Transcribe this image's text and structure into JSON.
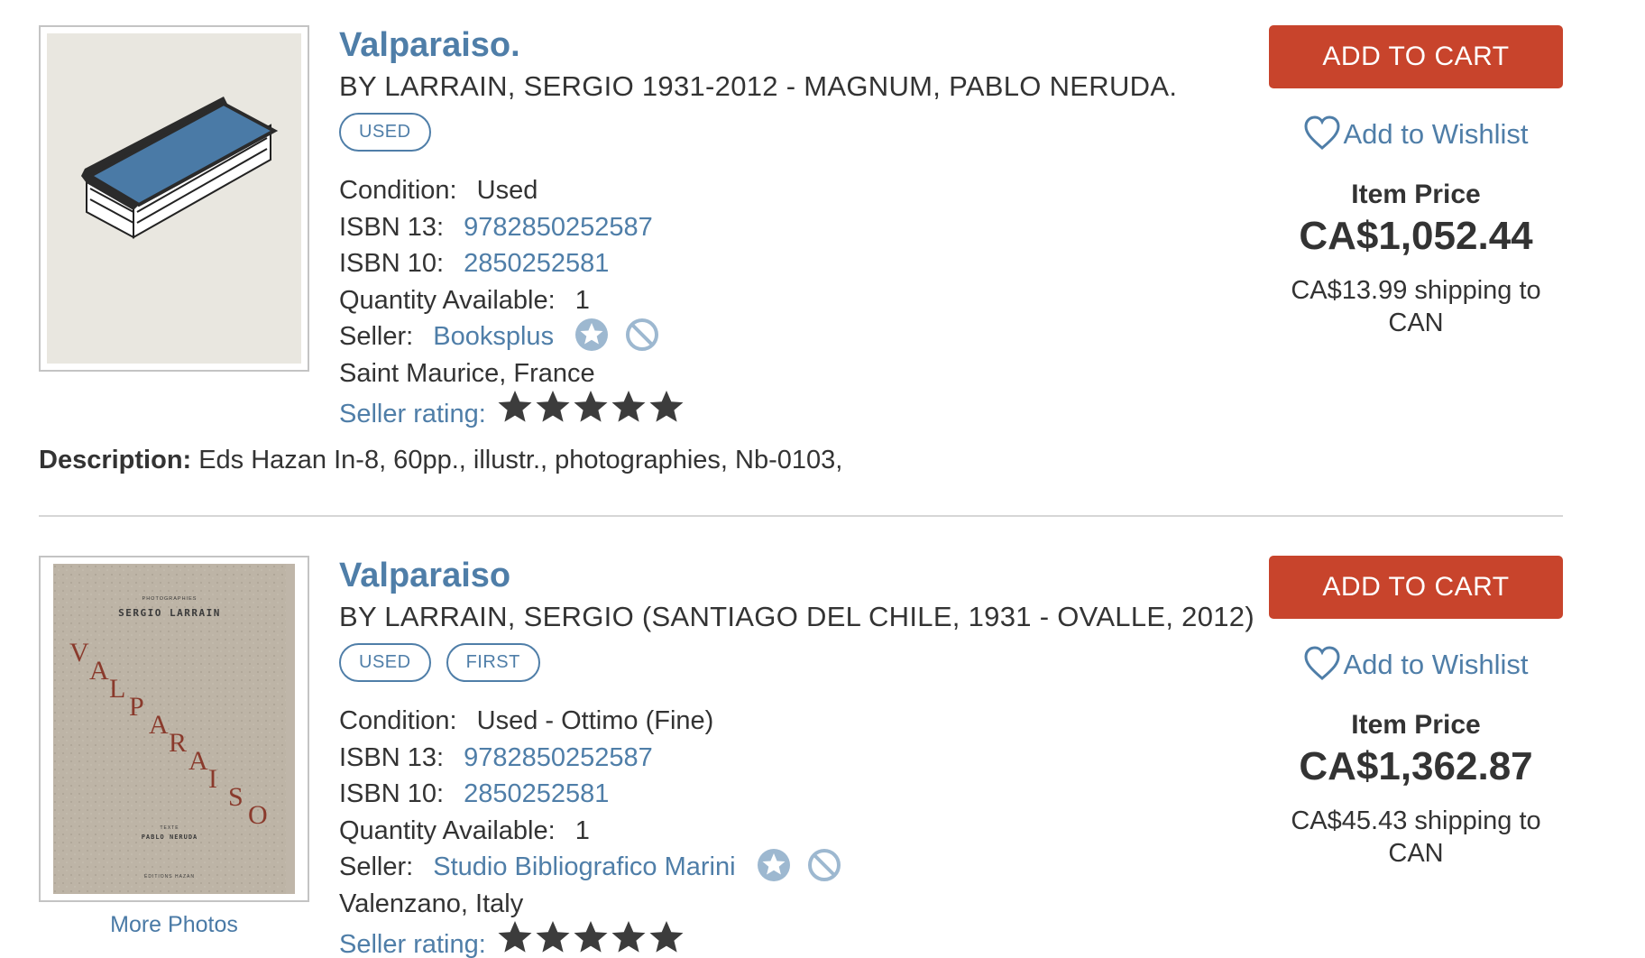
{
  "listings": [
    {
      "title": "Valparaiso.",
      "author": "BY LARRAIN, SERGIO 1931-2012 - MAGNUM, PABLO NERUDA.",
      "tags": [
        "USED"
      ],
      "condition_label": "Condition:",
      "condition": "Used",
      "isbn13_label": "ISBN 13:",
      "isbn13": "9782850252587",
      "isbn10_label": "ISBN 10:",
      "isbn10": "2850252581",
      "quantity_label": "Quantity Available:",
      "quantity": "1",
      "seller_label": "Seller:",
      "seller": "Booksplus",
      "location": "Saint Maurice, France",
      "rating_label": "Seller rating:",
      "rating_stars": 5,
      "description_label": "Description:",
      "description": "Eds Hazan In-8, 60pp., illustr., photographies, Nb-0103,",
      "add_to_cart": "ADD TO CART",
      "wishlist": "Add to Wishlist",
      "price_label": "Item Price",
      "price": "CA$1,052.44",
      "shipping_line1": "CA$13.99 shipping to",
      "shipping_line2": "CAN",
      "image": "book-placeholder-icon"
    },
    {
      "title": "Valparaiso",
      "author": "BY LARRAIN, SERGIO (SANTIAGO DEL CHILE, 1931 - OVALLE, 2012)",
      "tags": [
        "USED",
        "FIRST"
      ],
      "condition_label": "Condition:",
      "condition": "Used - Ottimo (Fine)",
      "isbn13_label": "ISBN 13:",
      "isbn13": "9782850252587",
      "isbn10_label": "ISBN 10:",
      "isbn10": "2850252581",
      "quantity_label": "Quantity Available:",
      "quantity": "1",
      "seller_label": "Seller:",
      "seller": "Studio Bibliografico Marini",
      "location": "Valenzano, Italy",
      "rating_label": "Seller rating:",
      "rating_stars": 5,
      "more_photos": "More Photos",
      "cover": {
        "top_small": "PHOTOGRAPHIES",
        "author": "SERGIO LARRAIN",
        "letters": [
          "V",
          "A",
          "L",
          "P",
          "A",
          "R",
          "A",
          "I",
          "S",
          "O"
        ],
        "texts": "TEXTE",
        "poet": "PABLO NERUDA",
        "publisher": "ÉDITIONS HAZAN"
      },
      "add_to_cart": "ADD TO CART",
      "wishlist": "Add to Wishlist",
      "price_label": "Item Price",
      "price": "CA$1,362.87",
      "shipping_line1": "CA$45.43 shipping to",
      "shipping_line2": "CAN",
      "image": "book-cover-photo"
    }
  ],
  "colors": {
    "link": "#4f7ea8",
    "cart": "#c8442c",
    "text": "#333333",
    "star": "#3c3c3c"
  }
}
